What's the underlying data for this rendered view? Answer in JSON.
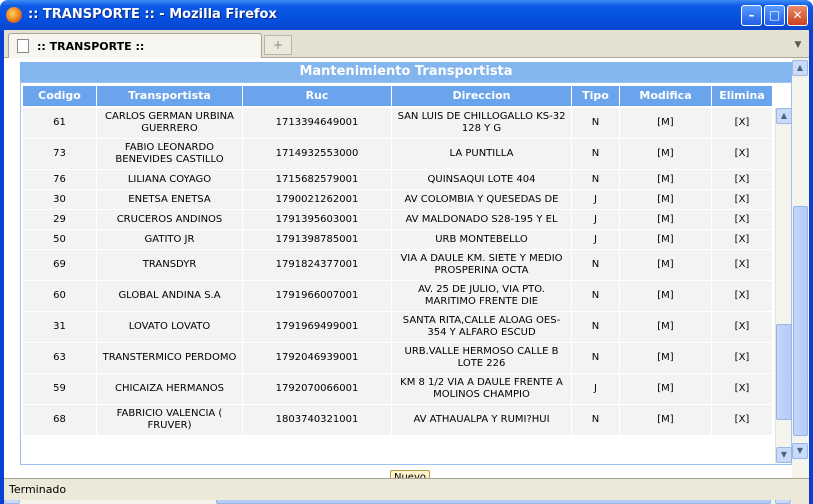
{
  "window": {
    "title": ":: TRANSPORTE :: - Mozilla Firefox",
    "minimize_symbol": "–",
    "maximize_symbol": "□",
    "close_symbol": "✕"
  },
  "tabs": [
    {
      "label": ":: TRANSPORTE ::"
    }
  ],
  "tabbar": {
    "new_tab_symbol": "+",
    "list_all_symbol": "▼"
  },
  "page": {
    "header": "Mantenimiento Transportista",
    "columns": [
      "Codigo",
      "Transportista",
      "Ruc",
      "Direccion",
      "Tipo",
      "Modifica",
      "Elimina"
    ],
    "rows": [
      {
        "codigo": "61",
        "transportista": "CARLOS GERMAN URBINA GUERRERO",
        "ruc": "1713394649001",
        "direccion": "SAN LUIS DE CHILLOGALLO KS-32 128 Y G",
        "tipo": "N",
        "modifica": "[M]",
        "elimina": "[X]"
      },
      {
        "codigo": "73",
        "transportista": "FABIO LEONARDO BENEVIDES CASTILLO",
        "ruc": "1714932553000",
        "direccion": "LA PUNTILLA",
        "tipo": "N",
        "modifica": "[M]",
        "elimina": "[X]"
      },
      {
        "codigo": "76",
        "transportista": "LILIANA COYAGO",
        "ruc": "1715682579001",
        "direccion": "QUINSAQUI LOTE 404",
        "tipo": "N",
        "modifica": "[M]",
        "elimina": "[X]"
      },
      {
        "codigo": "30",
        "transportista": "ENETSA ENETSA",
        "ruc": "1790021262001",
        "direccion": "AV COLOMBIA Y QUESEDAS DE",
        "tipo": "J",
        "modifica": "[M]",
        "elimina": "[X]"
      },
      {
        "codigo": "29",
        "transportista": "CRUCEROS ANDINOS",
        "ruc": "1791395603001",
        "direccion": "AV MALDONADO S28-195 Y EL",
        "tipo": "J",
        "modifica": "[M]",
        "elimina": "[X]"
      },
      {
        "codigo": "50",
        "transportista": "GATITO JR",
        "ruc": "1791398785001",
        "direccion": "URB MONTEBELLO",
        "tipo": "J",
        "modifica": "[M]",
        "elimina": "[X]"
      },
      {
        "codigo": "69",
        "transportista": "TRANSDYR",
        "ruc": "1791824377001",
        "direccion": "VIA A DAULE KM. SIETE Y MEDIO PROSPERINA OCTA",
        "tipo": "N",
        "modifica": "[M]",
        "elimina": "[X]"
      },
      {
        "codigo": "60",
        "transportista": "GLOBAL ANDINA S.A",
        "ruc": "1791966007001",
        "direccion": "AV. 25 DE JULIO, VIA PTO. MARITIMO FRENTE DIE",
        "tipo": "N",
        "modifica": "[M]",
        "elimina": "[X]"
      },
      {
        "codigo": "31",
        "transportista": "LOVATO LOVATO",
        "ruc": "1791969499001",
        "direccion": "SANTA RITA,CALLE ALOAG OES-354 Y ALFARO ESCUD",
        "tipo": "N",
        "modifica": "[M]",
        "elimina": "[X]"
      },
      {
        "codigo": "63",
        "transportista": "TRANSTERMICO PERDOMO",
        "ruc": "1792046939001",
        "direccion": "URB.VALLE HERMOSO CALLE B LOTE 226",
        "tipo": "N",
        "modifica": "[M]",
        "elimina": "[X]"
      },
      {
        "codigo": "59",
        "transportista": "CHICAIZA HERMANOS",
        "ruc": "1792070066001",
        "direccion": "KM 8 1/2 VIA A DAULE FRENTE A MOLINOS CHAMPIO",
        "tipo": "J",
        "modifica": "[M]",
        "elimina": "[X]"
      },
      {
        "codigo": "68",
        "transportista": "FABRICIO VALENCIA ( FRUVER)",
        "ruc": "1803740321001",
        "direccion": "AV ATHAUALPA Y RUMI?HUI",
        "tipo": "N",
        "modifica": "[M]",
        "elimina": "[X]"
      }
    ],
    "nuevo_button": "Nuevo"
  },
  "scroll_symbols": {
    "up": "▲",
    "down": "▼",
    "left": "◀",
    "right": "▶"
  },
  "statusbar": {
    "text": "Terminado"
  },
  "colors": {
    "titlebar": "#0550e0",
    "table_header": "#6aa4ec",
    "section_header": "#83b5ee",
    "row_background": "#f3f3f3",
    "button_background": "#fff4cf"
  }
}
